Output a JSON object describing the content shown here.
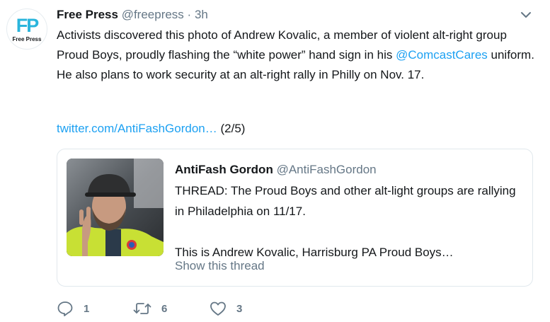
{
  "avatar": {
    "logo_text": "FP",
    "logo_label": "Free Press",
    "brand_color": "#2ab5dc"
  },
  "tweet": {
    "display_name": "Free Press",
    "handle": "@freepress",
    "separator": "·",
    "time": "3h",
    "text_before": "Activists discovered this photo of Andrew Kovalic, a member of violent alt-right group Proud Boys, proudly flashing the “white power” hand sign in his ",
    "mention": "@ComcastCares",
    "text_after": " uniform. He also plans to work security at an alt-right rally in Philly on Nov. 17.",
    "link": "twitter.com/AntiFashGordon…",
    "thread_position": "(2/5)",
    "link_color": "#1da1f2",
    "menu_icon": "chevron-down-icon"
  },
  "quoted": {
    "display_name": "AntiFash Gordon",
    "handle": "@AntiFashGordon",
    "text_line1": "THREAD: The Proud Boys and other alt-light groups are rallying in Philadelphia on 11/17.",
    "text_line2": "This is Andrew Kovalic, Harrisburg PA Proud Boys…",
    "show_thread": "Show this thread",
    "photo_icon": "selfie-photo"
  },
  "actions": {
    "reply": {
      "icon": "reply-icon",
      "count": "1"
    },
    "retweet": {
      "icon": "retweet-icon",
      "count": "6"
    },
    "like": {
      "icon": "heart-icon",
      "count": "3"
    }
  }
}
